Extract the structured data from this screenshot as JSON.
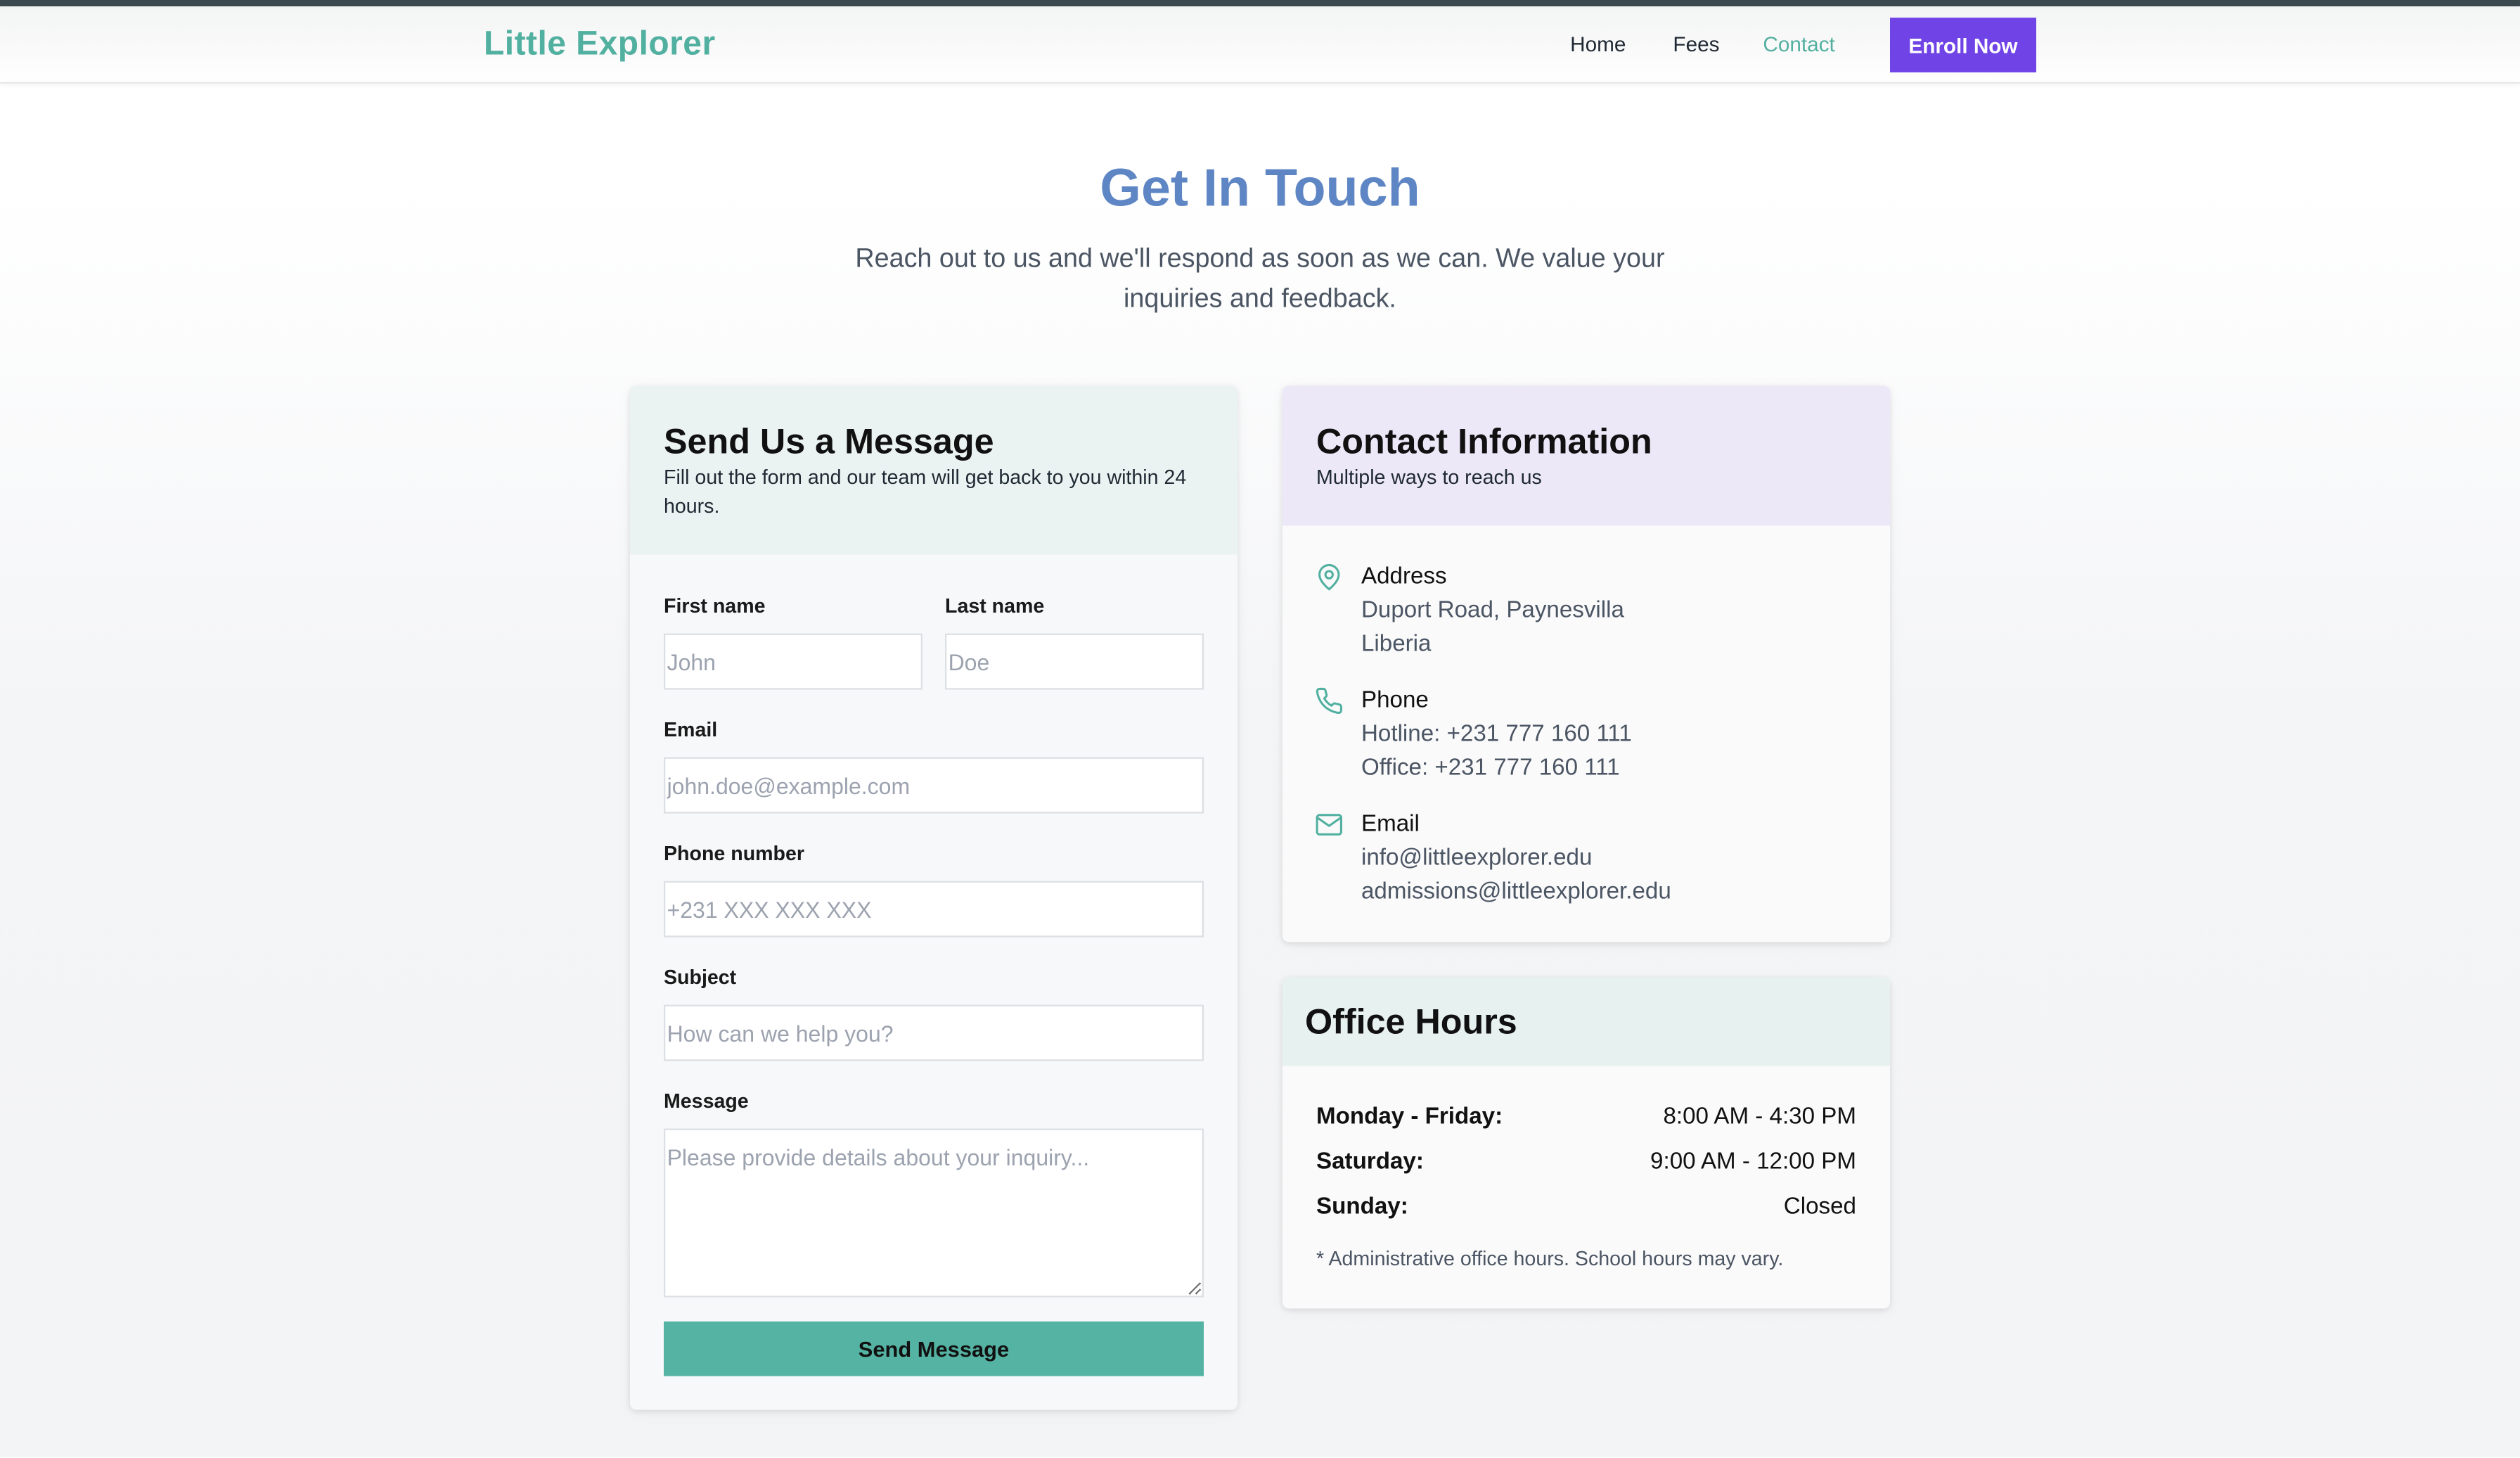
{
  "header": {
    "logo": "Little Explorer",
    "nav": {
      "home": "Home",
      "fees": "Fees",
      "contact": "Contact"
    },
    "enroll": "Enroll Now"
  },
  "hero": {
    "title": "Get In Touch",
    "subtitle": "Reach out to us and we'll respond as soon as we can. We value your inquiries and feedback."
  },
  "form": {
    "title": "Send Us a Message",
    "description": "Fill out the form and our team will get back to you within 24 hours.",
    "first_name": {
      "label": "First name",
      "placeholder": "John"
    },
    "last_name": {
      "label": "Last name",
      "placeholder": "Doe"
    },
    "email": {
      "label": "Email",
      "placeholder": "john.doe@example.com"
    },
    "phone": {
      "label": "Phone number",
      "placeholder": "+231 XXX XXX XXX"
    },
    "subject": {
      "label": "Subject",
      "placeholder": "How can we help you?"
    },
    "message": {
      "label": "Message",
      "placeholder": "Please provide details about your inquiry..."
    },
    "submit": "Send Message"
  },
  "contact_info": {
    "title": "Contact Information",
    "description": "Multiple ways to reach us",
    "address": {
      "title": "Address",
      "line1": "Duport Road, Paynesvilla",
      "line2": "Liberia",
      "icon": "map-pin-icon"
    },
    "phone": {
      "title": "Phone",
      "line1": "Hotline: +231 777 160 111",
      "line2": "Office: +231 777 160 111",
      "icon": "phone-icon"
    },
    "email": {
      "title": "Email",
      "line1": "info@littleexplorer.edu",
      "line2": "admissions@littleexplorer.edu",
      "icon": "mail-icon"
    }
  },
  "office_hours": {
    "title": "Office Hours",
    "rows": [
      {
        "day": "Monday - Friday:",
        "time": "8:00 AM - 4:30 PM"
      },
      {
        "day": "Saturday:",
        "time": "9:00 AM - 12:00 PM"
      },
      {
        "day": "Sunday:",
        "time": "Closed"
      }
    ],
    "note": "* Administrative office hours. School hours may vary."
  },
  "colors": {
    "brand": "#52b0a0",
    "title_blue": "#5f86c4",
    "enroll_purple": "#7043e6",
    "send_button": "#55b3a3"
  }
}
